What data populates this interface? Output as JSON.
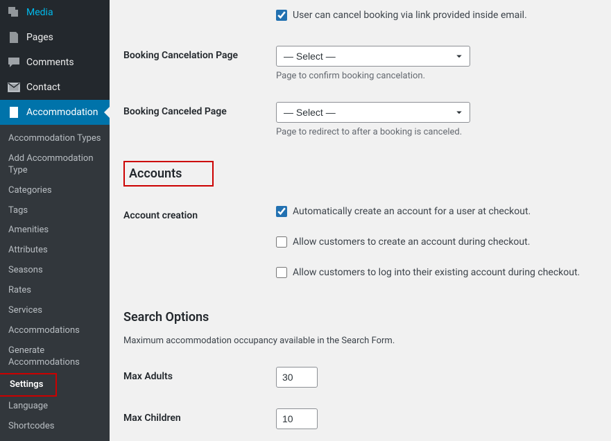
{
  "sidebar": {
    "media": "Media",
    "pages": "Pages",
    "comments": "Comments",
    "contact": "Contact",
    "accommodation": "Accommodation",
    "sub": {
      "types": "Accommodation Types",
      "addType": "Add Accommodation Type",
      "categories": "Categories",
      "tags": "Tags",
      "amenities": "Amenities",
      "attributes": "Attributes",
      "seasons": "Seasons",
      "rates": "Rates",
      "services": "Services",
      "accommodations": "Accommodations",
      "generate": "Generate Accommodations",
      "settings": "Settings",
      "language": "Language",
      "shortcodes": "Shortcodes"
    }
  },
  "form": {
    "cancelViaEmail": "User can cancel booking via link provided inside email.",
    "cancelPageLabel": "Booking Cancelation Page",
    "cancelPageHelp": "Page to confirm booking cancelation.",
    "canceledPageLabel": "Booking Canceled Page",
    "canceledPageHelp": "Page to redirect to after a booking is canceled.",
    "selectPlaceholder": "— Select —",
    "accountsHeading": "Accounts",
    "accountCreationLabel": "Account creation",
    "autoCreate": "Automatically create an account for a user at checkout.",
    "allowCreate": "Allow customers to create an account during checkout.",
    "allowLogin": "Allow customers to log into their existing account during checkout.",
    "searchHeading": "Search Options",
    "searchDesc": "Maximum accommodation occupancy available in the Search Form.",
    "maxAdultsLabel": "Max Adults",
    "maxAdultsValue": "30",
    "maxChildrenLabel": "Max Children",
    "maxChildrenValue": "10"
  }
}
